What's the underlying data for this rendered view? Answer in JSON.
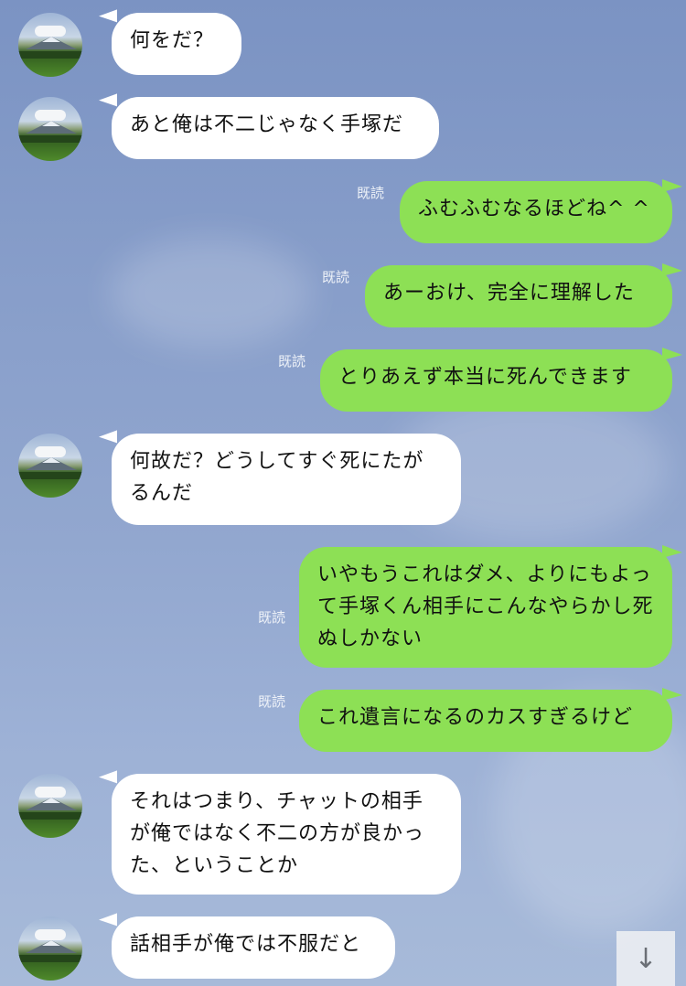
{
  "chat": {
    "read_label": "既読",
    "messages": [
      {
        "side": "left",
        "text": "何をだ？"
      },
      {
        "side": "left",
        "text": "あと俺は不二じゃなく手塚だ"
      },
      {
        "side": "right",
        "text": "ふむふむなるほどね^ ^",
        "read": "既読"
      },
      {
        "side": "right",
        "text": "あーおけ、完全に理解した",
        "read": "既読"
      },
      {
        "side": "right",
        "text": "とりあえず本当に死んできます",
        "read": "既読"
      },
      {
        "side": "left",
        "text": "何故だ？どうしてすぐ死にたがるんだ"
      },
      {
        "side": "right",
        "text": "いやもうこれはダメ、よりにもよって手塚くん相手にこんなやらかし死ぬしかない",
        "read": "既読"
      },
      {
        "side": "right",
        "text": "これ遺言になるのカスすぎるけど",
        "read": "既読"
      },
      {
        "side": "left",
        "text": "それはつまり、チャットの相手が俺ではなく不二の方が良かった、ということか"
      },
      {
        "side": "left",
        "text": "話相手が俺では不服だと"
      }
    ]
  },
  "controls": {
    "scroll_down_icon": "arrow-down-icon",
    "scroll_down_glyph": "↓"
  },
  "colors": {
    "incoming_bubble": "#ffffff",
    "outgoing_bubble": "#8de055",
    "background": "#8aa0cb"
  }
}
